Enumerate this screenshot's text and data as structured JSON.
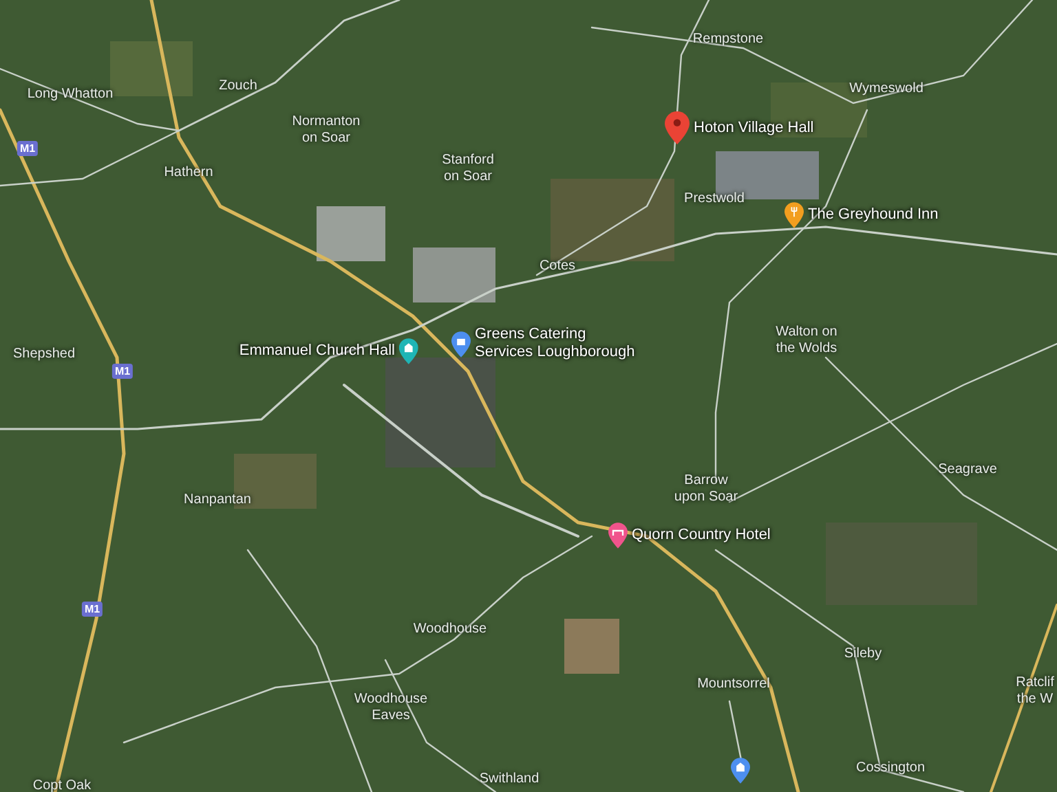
{
  "map": {
    "places": [
      {
        "lines": [
          "Long Whatton"
        ]
      },
      {
        "lines": [
          "Zouch"
        ]
      },
      {
        "lines": [
          "Normanton",
          "on Soar"
        ]
      },
      {
        "lines": [
          "Hathern"
        ]
      },
      {
        "lines": [
          "Stanford",
          "on Soar"
        ]
      },
      {
        "lines": [
          "Rempstone"
        ]
      },
      {
        "lines": [
          "Wymeswold"
        ]
      },
      {
        "lines": [
          "Prestwold"
        ]
      },
      {
        "lines": [
          "Cotes"
        ]
      },
      {
        "lines": [
          "Shepshed"
        ]
      },
      {
        "lines": [
          "Walton on",
          "the Wolds"
        ]
      },
      {
        "lines": [
          "Nanpantan"
        ]
      },
      {
        "lines": [
          "Barrow",
          "upon Soar"
        ]
      },
      {
        "lines": [
          "Seagrave"
        ]
      },
      {
        "lines": [
          "Woodhouse"
        ]
      },
      {
        "lines": [
          "Woodhouse",
          "Eaves"
        ]
      },
      {
        "lines": [
          "Sileby"
        ]
      },
      {
        "lines": [
          "Mountsorrel"
        ]
      },
      {
        "lines": [
          "Ratclif",
          "the W"
        ]
      },
      {
        "lines": [
          "Cossington"
        ]
      },
      {
        "lines": [
          "Swithland"
        ]
      },
      {
        "lines": [
          "Copt Oak"
        ]
      }
    ],
    "pins": [
      {
        "kind": "marker",
        "color": "#ea4335",
        "lines": [
          "Hoton Village Hall"
        ]
      },
      {
        "kind": "restaurant",
        "color": "#f29e1f",
        "lines": [
          "The Greyhound Inn"
        ]
      },
      {
        "kind": "venue",
        "color": "#1fb5b5",
        "lines": [
          "Emmanuel Church Hall"
        ]
      },
      {
        "kind": "shop",
        "color": "#4d8ff0",
        "lines": [
          "Greens Catering",
          "Services Loughborough"
        ]
      },
      {
        "kind": "hotel",
        "color": "#f0548c",
        "lines": [
          "Quorn Country Hotel"
        ]
      },
      {
        "kind": "venue",
        "color": "#4d8ff0"
      }
    ],
    "road_shields": [
      {
        "label": "M1"
      },
      {
        "label": "M1"
      },
      {
        "label": "M1"
      }
    ]
  }
}
